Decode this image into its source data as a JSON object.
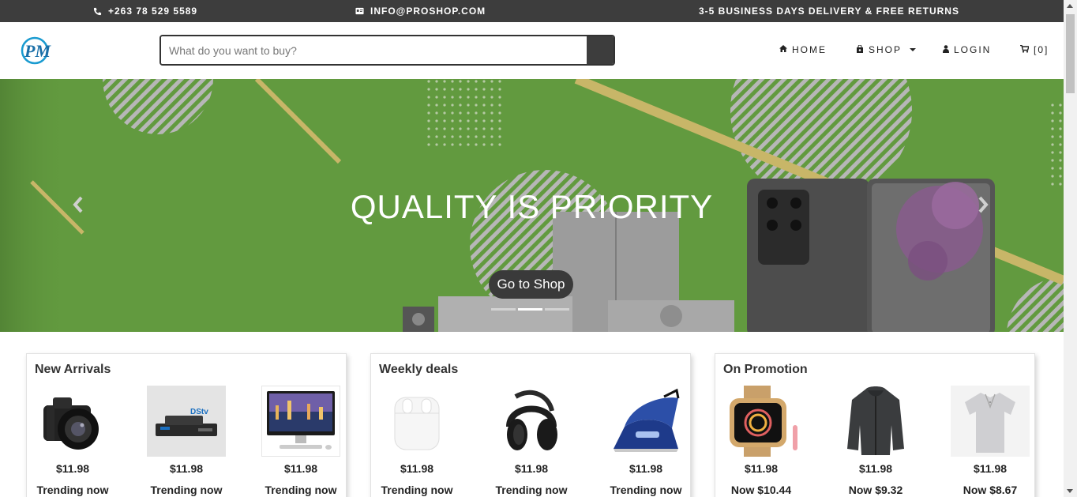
{
  "topbar": {
    "phone": "+263 78 529 5589",
    "email": "INFO@PROSHOP.COM",
    "delivery": "3-5 BUSINESS DAYS DELIVERY & FREE RETURNS"
  },
  "header": {
    "logo_text": "PM",
    "search_placeholder": "What do you want to buy?",
    "nav": {
      "home": "HOME",
      "shop": "SHOP",
      "login": "LOGIN",
      "cart": "[0]"
    }
  },
  "hero": {
    "title": "QUALITY IS PRIORITY",
    "button": "Go to Shop",
    "slides": 3,
    "active_slide": 2
  },
  "sections": [
    {
      "title": "New Arrivals",
      "products": [
        {
          "icon": "camera-icon",
          "price": "$11.98",
          "note": "Trending now"
        },
        {
          "icon": "tv-decoder-icon",
          "price": "$11.98",
          "note": "Trending now"
        },
        {
          "icon": "all-in-one-pc-icon",
          "price": "$11.98",
          "note": "Trending now"
        }
      ]
    },
    {
      "title": "Weekly deals",
      "products": [
        {
          "icon": "earbuds-icon",
          "price": "$11.98",
          "note": "Trending now"
        },
        {
          "icon": "headphones-icon",
          "price": "$11.98",
          "note": "Trending now"
        },
        {
          "icon": "steam-iron-icon",
          "price": "$11.98",
          "note": "Trending now"
        }
      ]
    },
    {
      "title": "On Promotion",
      "products": [
        {
          "icon": "smartwatch-icon",
          "price": "$11.98",
          "note": "Now $10.44"
        },
        {
          "icon": "jacket-icon",
          "price": "$11.98",
          "note": "Now $9.32"
        },
        {
          "icon": "polo-shirt-icon",
          "price": "$11.98",
          "note": "Now $8.67"
        }
      ]
    }
  ],
  "colors": {
    "topbar_bg": "#3d3d3d",
    "hero_bg": "#629a3f",
    "logo_accent": "#1a9bd0"
  }
}
